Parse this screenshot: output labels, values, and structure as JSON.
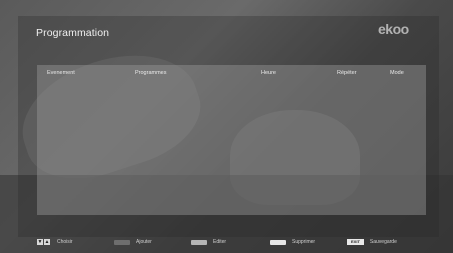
{
  "screen": {
    "title": "Programmation",
    "logo": "ekoo"
  },
  "table": {
    "columns": [
      "Evenement",
      "Programmes",
      "Heure",
      "Répéter",
      "Mode"
    ],
    "rows": []
  },
  "footer": {
    "choose": "Choisir",
    "add": "Ajouter",
    "edit": "Editer",
    "delete": "Supprimer",
    "exit_key": "EXIT",
    "save": "Sauvegarde"
  },
  "colors": {
    "add_key": "#6e6e6e",
    "edit_key": "#b5b5b5",
    "delete_key": "#e6e6e6"
  }
}
